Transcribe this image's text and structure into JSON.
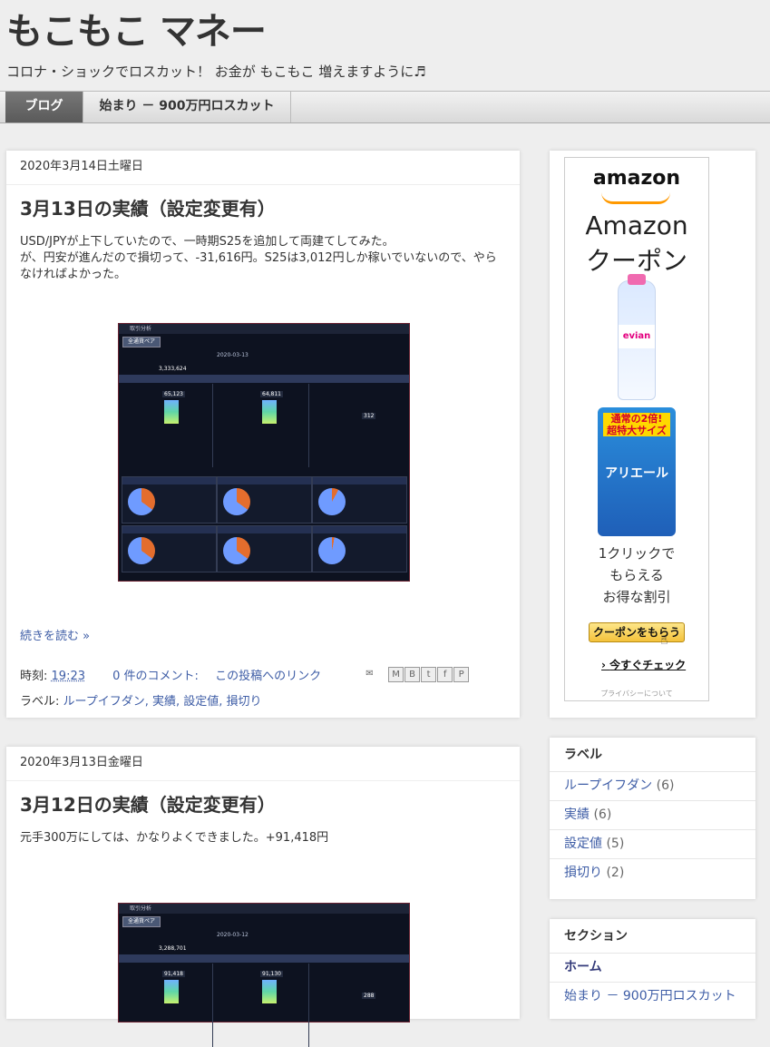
{
  "site": {
    "title": "もこもこ マネー",
    "description": "コロナ・ショックでロスカット！ お金が もこもこ 増えますように♬"
  },
  "tabs": [
    {
      "label": "ブログ",
      "active": true
    },
    {
      "label": "始まり － 900万円ロスカット",
      "active": false
    }
  ],
  "posts": [
    {
      "date": "2020年3月14日土曜日",
      "title": "3月13日の実績（設定変更有）",
      "body": [
        "USD/JPYが上下していたので、一時期S25を追加して両建てしてみた。",
        "が、円安が進んだので損切って、-31,616円。S25は3,012円しか稼いでいないので、やらなければよかった。"
      ],
      "screenshot": {
        "title": "取引分析",
        "button": "全通貨ペア",
        "date": "2020-03-13",
        "balance": "3,333,624",
        "values": [
          "65,123",
          "64,811",
          "312"
        ]
      },
      "read_more": "続きを読む »",
      "time_label": "時刻:",
      "time": "19:23",
      "comments": "0 件のコメント:",
      "permalink": "この投稿へのリンク",
      "labels_prefix": "ラベル:",
      "labels": "ループイフダン, 実績, 設定値, 損切り"
    },
    {
      "date": "2020年3月13日金曜日",
      "title": "3月12日の実績（設定変更有）",
      "body": [
        "元手300万にしては、かなりよくできました。+91,418円"
      ],
      "screenshot": {
        "title": "取引分析",
        "button": "全通貨ペア",
        "date": "2020-03-12",
        "balance": "3,288,701",
        "values": [
          "91,418",
          "91,130",
          "288"
        ]
      }
    }
  ],
  "ad": {
    "logo": "amazon",
    "headline1": "Amazon",
    "headline2": "クーポン",
    "line1": "1クリックで",
    "line2": "もらえる",
    "line3": "お得な割引",
    "button": "クーポンをもらう",
    "check": "今すぐチェック",
    "privacy": "プライバシーについて"
  },
  "labels_widget": {
    "title": "ラベル",
    "items": [
      {
        "name": "ループイフダン",
        "count": "(6)"
      },
      {
        "name": "実績",
        "count": "(6)"
      },
      {
        "name": "設定値",
        "count": "(5)"
      },
      {
        "name": "損切り",
        "count": "(2)"
      }
    ]
  },
  "section_widget": {
    "title": "セクション",
    "items": [
      "ホーム",
      "始まり － 900万円ロスカット"
    ]
  }
}
